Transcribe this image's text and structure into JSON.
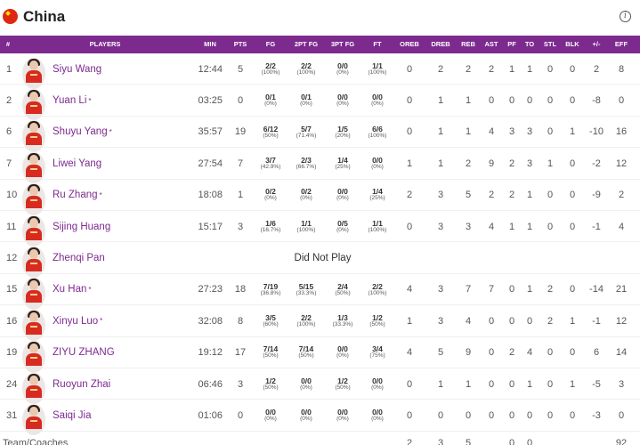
{
  "team": {
    "name": "China",
    "info_icon": "info-icon"
  },
  "columns": {
    "num": "#",
    "players": "PLAYERS",
    "min": "MIN",
    "pts": "PTS",
    "fg": "FG",
    "fg2": "2PT FG",
    "fg3": "3PT FG",
    "ft": "FT",
    "oreb": "OREB",
    "dreb": "DREB",
    "reb": "REB",
    "ast": "AST",
    "pf": "PF",
    "to": "TO",
    "stl": "STL",
    "blk": "BLK",
    "pm": "+/-",
    "eff": "EFF"
  },
  "players": [
    {
      "num": "1",
      "name": "Siyu Wang",
      "starter": false,
      "min": "12:44",
      "pts": "5",
      "fg": "2/2",
      "fg_pct": "(100%)",
      "fg2": "2/2",
      "fg2_pct": "(100%)",
      "fg3": "0/0",
      "fg3_pct": "(0%)",
      "ft": "1/1",
      "ft_pct": "(100%)",
      "oreb": "0",
      "dreb": "2",
      "reb": "2",
      "ast": "2",
      "pf": "1",
      "to": "1",
      "stl": "0",
      "blk": "0",
      "pm": "2",
      "eff": "8"
    },
    {
      "num": "2",
      "name": "Yuan Li",
      "starter": true,
      "min": "03:25",
      "pts": "0",
      "fg": "0/1",
      "fg_pct": "(0%)",
      "fg2": "0/1",
      "fg2_pct": "(0%)",
      "fg3": "0/0",
      "fg3_pct": "(0%)",
      "ft": "0/0",
      "ft_pct": "(0%)",
      "oreb": "0",
      "dreb": "1",
      "reb": "1",
      "ast": "0",
      "pf": "0",
      "to": "0",
      "stl": "0",
      "blk": "0",
      "pm": "-8",
      "eff": "0"
    },
    {
      "num": "6",
      "name": "Shuyu Yang",
      "starter": true,
      "min": "35:57",
      "pts": "19",
      "fg": "6/12",
      "fg_pct": "(50%)",
      "fg2": "5/7",
      "fg2_pct": "(71.4%)",
      "fg3": "1/5",
      "fg3_pct": "(20%)",
      "ft": "6/6",
      "ft_pct": "(100%)",
      "oreb": "0",
      "dreb": "1",
      "reb": "1",
      "ast": "4",
      "pf": "3",
      "to": "3",
      "stl": "0",
      "blk": "1",
      "pm": "-10",
      "eff": "16"
    },
    {
      "num": "7",
      "name": "Liwei Yang",
      "starter": false,
      "min": "27:54",
      "pts": "7",
      "fg": "3/7",
      "fg_pct": "(42.9%)",
      "fg2": "2/3",
      "fg2_pct": "(66.7%)",
      "fg3": "1/4",
      "fg3_pct": "(25%)",
      "ft": "0/0",
      "ft_pct": "(0%)",
      "oreb": "1",
      "dreb": "1",
      "reb": "2",
      "ast": "9",
      "pf": "2",
      "to": "3",
      "stl": "1",
      "blk": "0",
      "pm": "-2",
      "eff": "12"
    },
    {
      "num": "10",
      "name": "Ru Zhang",
      "starter": true,
      "min": "18:08",
      "pts": "1",
      "fg": "0/2",
      "fg_pct": "(0%)",
      "fg2": "0/2",
      "fg2_pct": "(0%)",
      "fg3": "0/0",
      "fg3_pct": "(0%)",
      "ft": "1/4",
      "ft_pct": "(25%)",
      "oreb": "2",
      "dreb": "3",
      "reb": "5",
      "ast": "2",
      "pf": "2",
      "to": "1",
      "stl": "0",
      "blk": "0",
      "pm": "-9",
      "eff": "2"
    },
    {
      "num": "11",
      "name": "Sijing Huang",
      "starter": false,
      "min": "15:17",
      "pts": "3",
      "fg": "1/6",
      "fg_pct": "(16.7%)",
      "fg2": "1/1",
      "fg2_pct": "(100%)",
      "fg3": "0/5",
      "fg3_pct": "(0%)",
      "ft": "1/1",
      "ft_pct": "(100%)",
      "oreb": "0",
      "dreb": "3",
      "reb": "3",
      "ast": "4",
      "pf": "1",
      "to": "1",
      "stl": "0",
      "blk": "0",
      "pm": "-1",
      "eff": "4"
    },
    {
      "num": "12",
      "name": "Zhenqi Pan",
      "starter": false,
      "dnp": "Did Not Play"
    },
    {
      "num": "15",
      "name": "Xu Han",
      "starter": true,
      "min": "27:23",
      "pts": "18",
      "fg": "7/19",
      "fg_pct": "(36.8%)",
      "fg2": "5/15",
      "fg2_pct": "(33.3%)",
      "fg3": "2/4",
      "fg3_pct": "(50%)",
      "ft": "2/2",
      "ft_pct": "(100%)",
      "oreb": "4",
      "dreb": "3",
      "reb": "7",
      "ast": "7",
      "pf": "0",
      "to": "1",
      "stl": "2",
      "blk": "0",
      "pm": "-14",
      "eff": "21"
    },
    {
      "num": "16",
      "name": "Xinyu Luo",
      "starter": true,
      "min": "32:08",
      "pts": "8",
      "fg": "3/5",
      "fg_pct": "(60%)",
      "fg2": "2/2",
      "fg2_pct": "(100%)",
      "fg3": "1/3",
      "fg3_pct": "(33.3%)",
      "ft": "1/2",
      "ft_pct": "(50%)",
      "oreb": "1",
      "dreb": "3",
      "reb": "4",
      "ast": "0",
      "pf": "0",
      "to": "0",
      "stl": "2",
      "blk": "1",
      "pm": "-1",
      "eff": "12"
    },
    {
      "num": "19",
      "name": "ZIYU ZHANG",
      "starter": false,
      "min": "19:12",
      "pts": "17",
      "fg": "7/14",
      "fg_pct": "(50%)",
      "fg2": "7/14",
      "fg2_pct": "(50%)",
      "fg3": "0/0",
      "fg3_pct": "(0%)",
      "ft": "3/4",
      "ft_pct": "(75%)",
      "oreb": "4",
      "dreb": "5",
      "reb": "9",
      "ast": "0",
      "pf": "2",
      "to": "4",
      "stl": "0",
      "blk": "0",
      "pm": "6",
      "eff": "14"
    },
    {
      "num": "24",
      "name": "Ruoyun Zhai",
      "starter": false,
      "min": "06:46",
      "pts": "3",
      "fg": "1/2",
      "fg_pct": "(50%)",
      "fg2": "0/0",
      "fg2_pct": "(0%)",
      "fg3": "1/2",
      "fg3_pct": "(50%)",
      "ft": "0/0",
      "ft_pct": "(0%)",
      "oreb": "0",
      "dreb": "1",
      "reb": "1",
      "ast": "0",
      "pf": "0",
      "to": "1",
      "stl": "0",
      "blk": "1",
      "pm": "-5",
      "eff": "3"
    },
    {
      "num": "31",
      "name": "Saiqi Jia",
      "starter": false,
      "min": "01:06",
      "pts": "0",
      "fg": "0/0",
      "fg_pct": "(0%)",
      "fg2": "0/0",
      "fg2_pct": "(0%)",
      "fg3": "0/0",
      "fg3_pct": "(0%)",
      "ft": "0/0",
      "ft_pct": "(0%)",
      "oreb": "0",
      "dreb": "0",
      "reb": "0",
      "ast": "0",
      "pf": "0",
      "to": "0",
      "stl": "0",
      "blk": "0",
      "pm": "-3",
      "eff": "0"
    }
  ],
  "team_row": {
    "label": "Team/Coaches",
    "oreb": "2",
    "dreb": "3",
    "reb": "5",
    "pf": "0",
    "to": "0",
    "eff": "92"
  },
  "colors": {
    "header_bg": "#7d2a8f",
    "accent": "#7d2a8f",
    "flag": "#de2910"
  }
}
